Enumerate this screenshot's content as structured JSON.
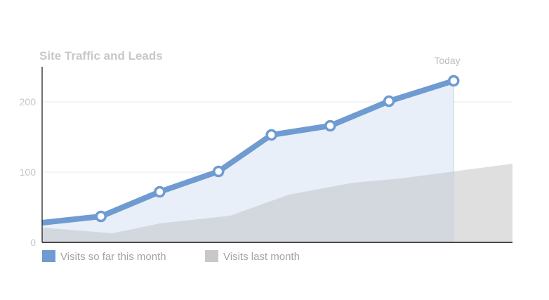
{
  "chart_data": {
    "type": "area",
    "title": "Site Traffic and Leads",
    "annotation": "Today",
    "x": [
      0,
      1,
      2,
      3,
      4,
      5,
      6,
      7,
      8
    ],
    "ylim": [
      0,
      250
    ],
    "yticks": [
      0,
      100,
      200
    ],
    "grid": true,
    "legend_position": "bottom-left",
    "series": [
      {
        "name": "Visits so far this month",
        "color": "#6f9bd1",
        "kind": "line-with-markers",
        "points": [
          {
            "x": 0.0,
            "y": 28
          },
          {
            "x": 1.0,
            "y": 37
          },
          {
            "x": 2.0,
            "y": 72
          },
          {
            "x": 3.0,
            "y": 101
          },
          {
            "x": 3.9,
            "y": 153
          },
          {
            "x": 4.9,
            "y": 166
          },
          {
            "x": 5.9,
            "y": 201
          },
          {
            "x": 7.0,
            "y": 230
          }
        ],
        "markers_start_index": 1
      },
      {
        "name": "Visits last month",
        "color": "#c8c8c8",
        "kind": "area",
        "points": [
          {
            "x": 0.0,
            "y": 21
          },
          {
            "x": 1.2,
            "y": 13
          },
          {
            "x": 2.0,
            "y": 27
          },
          {
            "x": 3.2,
            "y": 38
          },
          {
            "x": 4.2,
            "y": 68
          },
          {
            "x": 5.3,
            "y": 85
          },
          {
            "x": 6.1,
            "y": 91
          },
          {
            "x": 7.0,
            "y": 101
          },
          {
            "x": 8.0,
            "y": 112
          }
        ]
      }
    ],
    "today_x": 7.0
  },
  "colors": {
    "current": "#6f9bd1",
    "current_fill": "#e8eff8",
    "last_month": "#c8c8c8",
    "last_month_fill_past": "#d3d8df",
    "last_month_fill_future": "#dfdfdf",
    "grid": "#e8e8e8",
    "axis": "#111111"
  }
}
